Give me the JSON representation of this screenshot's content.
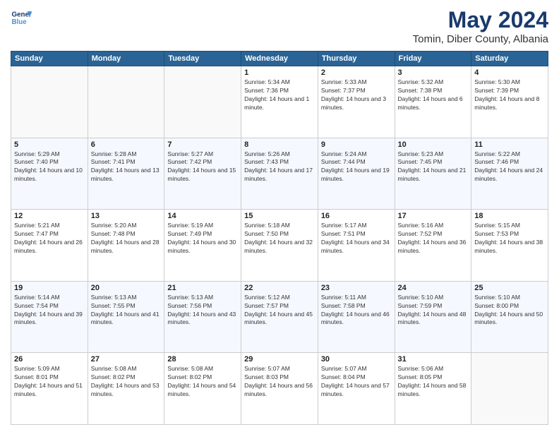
{
  "header": {
    "logo_line1": "General",
    "logo_line2": "Blue",
    "month": "May 2024",
    "location": "Tomin, Diber County, Albania"
  },
  "weekdays": [
    "Sunday",
    "Monday",
    "Tuesday",
    "Wednesday",
    "Thursday",
    "Friday",
    "Saturday"
  ],
  "weeks": [
    [
      {
        "day": "",
        "sunrise": "",
        "sunset": "",
        "daylight": ""
      },
      {
        "day": "",
        "sunrise": "",
        "sunset": "",
        "daylight": ""
      },
      {
        "day": "",
        "sunrise": "",
        "sunset": "",
        "daylight": ""
      },
      {
        "day": "1",
        "sunrise": "Sunrise: 5:34 AM",
        "sunset": "Sunset: 7:36 PM",
        "daylight": "Daylight: 14 hours and 1 minute."
      },
      {
        "day": "2",
        "sunrise": "Sunrise: 5:33 AM",
        "sunset": "Sunset: 7:37 PM",
        "daylight": "Daylight: 14 hours and 3 minutes."
      },
      {
        "day": "3",
        "sunrise": "Sunrise: 5:32 AM",
        "sunset": "Sunset: 7:38 PM",
        "daylight": "Daylight: 14 hours and 6 minutes."
      },
      {
        "day": "4",
        "sunrise": "Sunrise: 5:30 AM",
        "sunset": "Sunset: 7:39 PM",
        "daylight": "Daylight: 14 hours and 8 minutes."
      }
    ],
    [
      {
        "day": "5",
        "sunrise": "Sunrise: 5:29 AM",
        "sunset": "Sunset: 7:40 PM",
        "daylight": "Daylight: 14 hours and 10 minutes."
      },
      {
        "day": "6",
        "sunrise": "Sunrise: 5:28 AM",
        "sunset": "Sunset: 7:41 PM",
        "daylight": "Daylight: 14 hours and 13 minutes."
      },
      {
        "day": "7",
        "sunrise": "Sunrise: 5:27 AM",
        "sunset": "Sunset: 7:42 PM",
        "daylight": "Daylight: 14 hours and 15 minutes."
      },
      {
        "day": "8",
        "sunrise": "Sunrise: 5:26 AM",
        "sunset": "Sunset: 7:43 PM",
        "daylight": "Daylight: 14 hours and 17 minutes."
      },
      {
        "day": "9",
        "sunrise": "Sunrise: 5:24 AM",
        "sunset": "Sunset: 7:44 PM",
        "daylight": "Daylight: 14 hours and 19 minutes."
      },
      {
        "day": "10",
        "sunrise": "Sunrise: 5:23 AM",
        "sunset": "Sunset: 7:45 PM",
        "daylight": "Daylight: 14 hours and 21 minutes."
      },
      {
        "day": "11",
        "sunrise": "Sunrise: 5:22 AM",
        "sunset": "Sunset: 7:46 PM",
        "daylight": "Daylight: 14 hours and 24 minutes."
      }
    ],
    [
      {
        "day": "12",
        "sunrise": "Sunrise: 5:21 AM",
        "sunset": "Sunset: 7:47 PM",
        "daylight": "Daylight: 14 hours and 26 minutes."
      },
      {
        "day": "13",
        "sunrise": "Sunrise: 5:20 AM",
        "sunset": "Sunset: 7:48 PM",
        "daylight": "Daylight: 14 hours and 28 minutes."
      },
      {
        "day": "14",
        "sunrise": "Sunrise: 5:19 AM",
        "sunset": "Sunset: 7:49 PM",
        "daylight": "Daylight: 14 hours and 30 minutes."
      },
      {
        "day": "15",
        "sunrise": "Sunrise: 5:18 AM",
        "sunset": "Sunset: 7:50 PM",
        "daylight": "Daylight: 14 hours and 32 minutes."
      },
      {
        "day": "16",
        "sunrise": "Sunrise: 5:17 AM",
        "sunset": "Sunset: 7:51 PM",
        "daylight": "Daylight: 14 hours and 34 minutes."
      },
      {
        "day": "17",
        "sunrise": "Sunrise: 5:16 AM",
        "sunset": "Sunset: 7:52 PM",
        "daylight": "Daylight: 14 hours and 36 minutes."
      },
      {
        "day": "18",
        "sunrise": "Sunrise: 5:15 AM",
        "sunset": "Sunset: 7:53 PM",
        "daylight": "Daylight: 14 hours and 38 minutes."
      }
    ],
    [
      {
        "day": "19",
        "sunrise": "Sunrise: 5:14 AM",
        "sunset": "Sunset: 7:54 PM",
        "daylight": "Daylight: 14 hours and 39 minutes."
      },
      {
        "day": "20",
        "sunrise": "Sunrise: 5:13 AM",
        "sunset": "Sunset: 7:55 PM",
        "daylight": "Daylight: 14 hours and 41 minutes."
      },
      {
        "day": "21",
        "sunrise": "Sunrise: 5:13 AM",
        "sunset": "Sunset: 7:56 PM",
        "daylight": "Daylight: 14 hours and 43 minutes."
      },
      {
        "day": "22",
        "sunrise": "Sunrise: 5:12 AM",
        "sunset": "Sunset: 7:57 PM",
        "daylight": "Daylight: 14 hours and 45 minutes."
      },
      {
        "day": "23",
        "sunrise": "Sunrise: 5:11 AM",
        "sunset": "Sunset: 7:58 PM",
        "daylight": "Daylight: 14 hours and 46 minutes."
      },
      {
        "day": "24",
        "sunrise": "Sunrise: 5:10 AM",
        "sunset": "Sunset: 7:59 PM",
        "daylight": "Daylight: 14 hours and 48 minutes."
      },
      {
        "day": "25",
        "sunrise": "Sunrise: 5:10 AM",
        "sunset": "Sunset: 8:00 PM",
        "daylight": "Daylight: 14 hours and 50 minutes."
      }
    ],
    [
      {
        "day": "26",
        "sunrise": "Sunrise: 5:09 AM",
        "sunset": "Sunset: 8:01 PM",
        "daylight": "Daylight: 14 hours and 51 minutes."
      },
      {
        "day": "27",
        "sunrise": "Sunrise: 5:08 AM",
        "sunset": "Sunset: 8:02 PM",
        "daylight": "Daylight: 14 hours and 53 minutes."
      },
      {
        "day": "28",
        "sunrise": "Sunrise: 5:08 AM",
        "sunset": "Sunset: 8:02 PM",
        "daylight": "Daylight: 14 hours and 54 minutes."
      },
      {
        "day": "29",
        "sunrise": "Sunrise: 5:07 AM",
        "sunset": "Sunset: 8:03 PM",
        "daylight": "Daylight: 14 hours and 56 minutes."
      },
      {
        "day": "30",
        "sunrise": "Sunrise: 5:07 AM",
        "sunset": "Sunset: 8:04 PM",
        "daylight": "Daylight: 14 hours and 57 minutes."
      },
      {
        "day": "31",
        "sunrise": "Sunrise: 5:06 AM",
        "sunset": "Sunset: 8:05 PM",
        "daylight": "Daylight: 14 hours and 58 minutes."
      },
      {
        "day": "",
        "sunrise": "",
        "sunset": "",
        "daylight": ""
      }
    ]
  ]
}
